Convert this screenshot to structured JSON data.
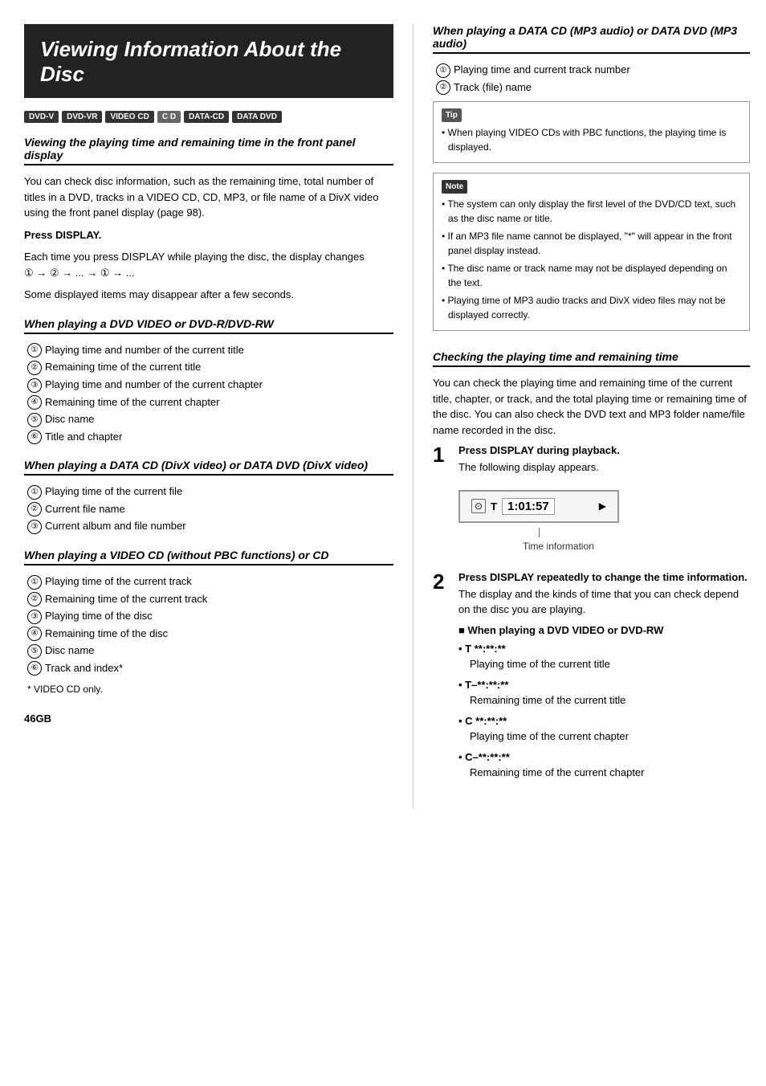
{
  "page_title": "Viewing Information About the Disc",
  "badges": [
    "DVD-V",
    "DVD-VR",
    "VIDEO CD",
    "C D",
    "DATA-CD",
    "DATA DVD"
  ],
  "section1": {
    "title": "Viewing the playing time and remaining time in the front panel display",
    "body": "You can check disc information, such as the remaining time, total number of titles in a DVD, tracks in a VIDEO CD, CD, MP3, or file name of a DivX video using the front panel display (page 98).",
    "press_label": "Press DISPLAY.",
    "press_body": "Each time you press DISPLAY while playing the disc, the display changes ",
    "press_flow": "① → ② → ... → ① → ...",
    "footnote": "Some displayed items may disappear after a few seconds."
  },
  "dvd_section": {
    "title": "When playing a DVD VIDEO or DVD-R/DVD-RW",
    "items": [
      "Playing time and number of the current title",
      "Remaining time of the current title",
      "Playing time and number of the current chapter",
      "Remaining time of the current chapter",
      "Disc name",
      "Title and chapter"
    ]
  },
  "divx_section": {
    "title": "When playing a DATA CD (DivX video) or DATA DVD (DivX video)",
    "items": [
      "Playing time of the current file",
      "Current file name",
      "Current album and file number"
    ]
  },
  "videocd_section": {
    "title": "When playing a VIDEO CD (without PBC functions) or CD",
    "items": [
      "Playing time of the current track",
      "Remaining time of the current track",
      "Playing time of the disc",
      "Remaining time of the disc",
      "Disc name",
      "Track and index*"
    ],
    "footnote": "VIDEO CD only."
  },
  "mp3_section": {
    "title": "When playing a DATA CD (MP3 audio) or DATA DVD (MP3 audio)",
    "items": [
      "Playing time and current track number",
      "Track (file) name"
    ],
    "tip": {
      "header": "Tip",
      "items": [
        "When playing VIDEO CDs with PBC functions, the playing time is displayed."
      ]
    },
    "note": {
      "header": "Note",
      "items": [
        "The system can only display the first level of the DVD/CD text, such as the disc name or title.",
        "If an MP3 file name cannot be displayed, \"*\" will appear in the front panel display instead.",
        "The disc name or track name may not be displayed depending on the text.",
        "Playing time of MP3 audio tracks and DivX video files may not be displayed correctly."
      ]
    }
  },
  "checking_section": {
    "title": "Checking the playing time and remaining time",
    "intro": "You can check the playing time and remaining time of the current title, chapter, or track, and the total playing time or remaining time of the disc. You can also check the DVD text and MP3 folder name/file name recorded in the disc.",
    "step1": {
      "num": "1",
      "title": "Press DISPLAY during playback.",
      "body": "The following display appears.",
      "display": {
        "icon": "⊙",
        "label": "T",
        "time": "1:01:57",
        "arrow": "▶",
        "caption": "Time information"
      }
    },
    "step2": {
      "num": "2",
      "title": "Press DISPLAY repeatedly to change the time information.",
      "body": "The display and the kinds of time that you can check depend on the disc you are playing.",
      "dvd_subsection": {
        "title": "■ When playing a DVD VIDEO or DVD-RW",
        "bullets": [
          {
            "code": "T **:**:**",
            "desc": "Playing time of the current title"
          },
          {
            "code": "T–**:**:**",
            "desc": "Remaining time of the current title"
          },
          {
            "code": "C **:**:**",
            "desc": "Playing time of the current chapter"
          },
          {
            "code": "C–**:**:**",
            "desc": "Remaining time of the current chapter"
          }
        ]
      }
    }
  },
  "page_number": "46GB"
}
